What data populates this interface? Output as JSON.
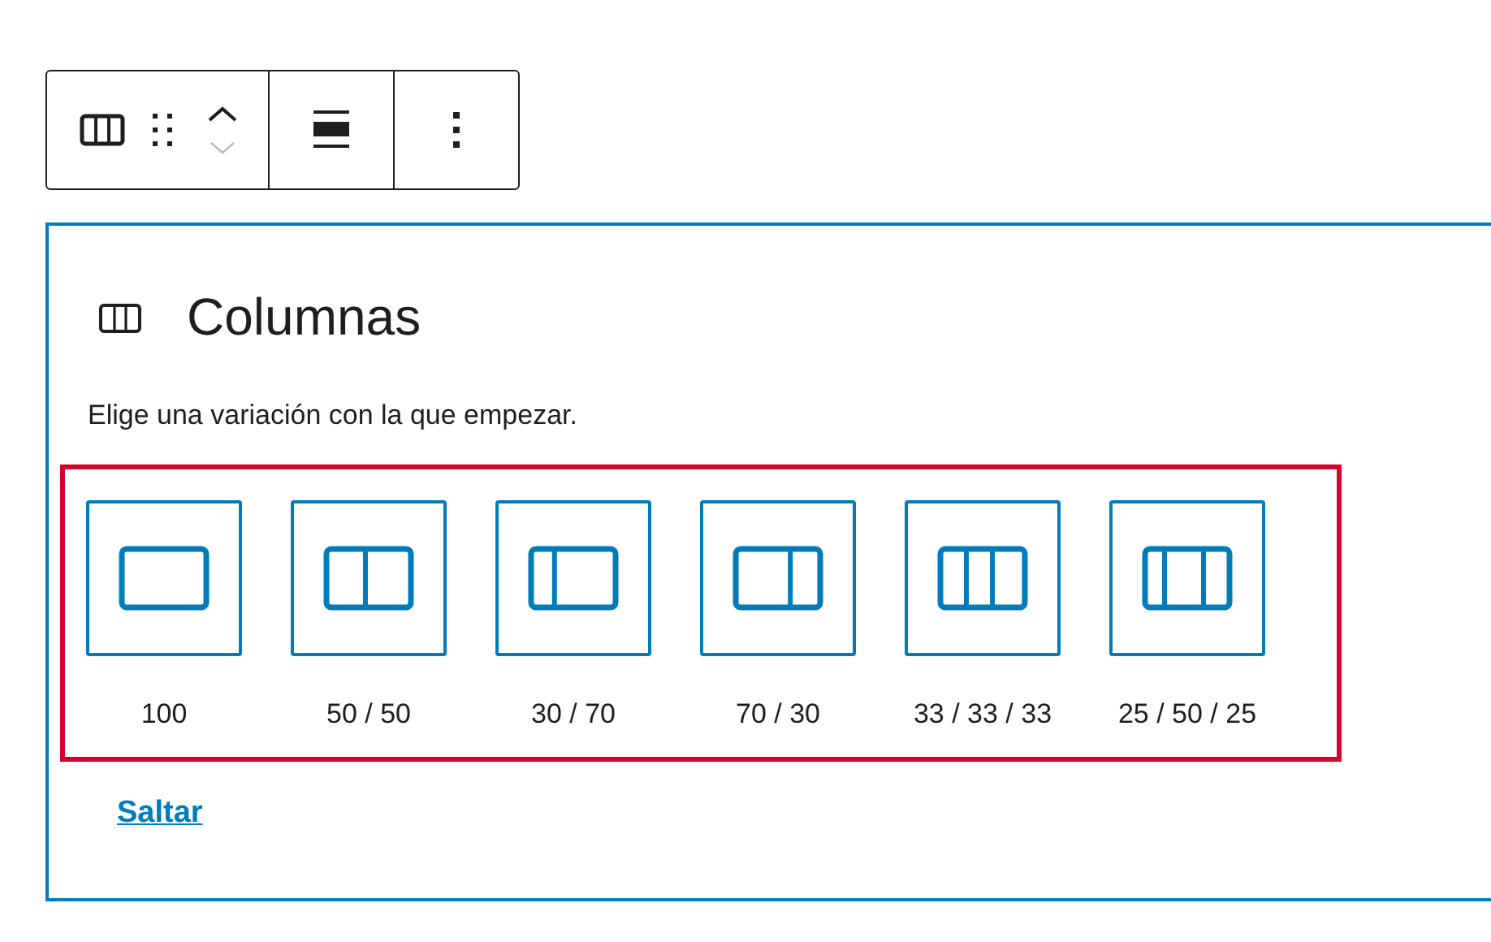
{
  "toolbar": {
    "groups": [
      {
        "kind": "block-tools"
      },
      {
        "kind": "align"
      },
      {
        "kind": "more"
      }
    ]
  },
  "block": {
    "title": "Columnas",
    "description": "Elige una variación con la que empezar.",
    "variations": [
      {
        "kind": "full",
        "label": "100"
      },
      {
        "kind": "halves",
        "label": "50 / 50"
      },
      {
        "kind": "narrowfirst",
        "label": "30 / 70"
      },
      {
        "kind": "widefirst",
        "label": "70 / 30"
      },
      {
        "kind": "thirds",
        "label": "33 / 33 / 33"
      },
      {
        "kind": "widecenter",
        "label": "25 / 50 / 25"
      }
    ],
    "skip_link": "Saltar"
  }
}
